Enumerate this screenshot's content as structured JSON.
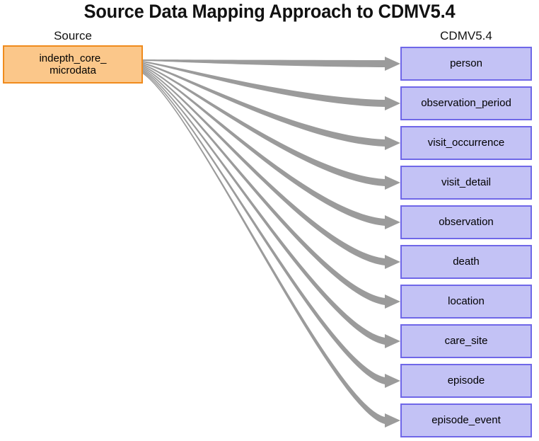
{
  "title": "Source Data Mapping Approach to CDMV5.4",
  "colors": {
    "source_fill": "#FBC78A",
    "source_border": "#F08B1D",
    "target_fill": "#C3C2F5",
    "target_border": "#6F67E8",
    "flow": "#9B9B9B",
    "text": "#000000",
    "background": "#FFFFFF"
  },
  "source": {
    "header": "Source",
    "node": {
      "label": "indepth_core_ microdata",
      "line1": "indepth_core_",
      "line2": "microdata"
    }
  },
  "target": {
    "header": "CDMV5.4",
    "nodes": [
      {
        "label": "person"
      },
      {
        "label": "observation_period"
      },
      {
        "label": "visit_occurrence"
      },
      {
        "label": "visit_detail"
      },
      {
        "label": "observation"
      },
      {
        "label": "death"
      },
      {
        "label": "location"
      },
      {
        "label": "care_site"
      },
      {
        "label": "episode"
      },
      {
        "label": "episode_event"
      }
    ]
  },
  "flows": [
    {
      "from": "indepth_core_microdata",
      "to": "person"
    },
    {
      "from": "indepth_core_microdata",
      "to": "observation_period"
    },
    {
      "from": "indepth_core_microdata",
      "to": "visit_occurrence"
    },
    {
      "from": "indepth_core_microdata",
      "to": "visit_detail"
    },
    {
      "from": "indepth_core_microdata",
      "to": "observation"
    },
    {
      "from": "indepth_core_microdata",
      "to": "death"
    },
    {
      "from": "indepth_core_microdata",
      "to": "location"
    },
    {
      "from": "indepth_core_microdata",
      "to": "care_site"
    },
    {
      "from": "indepth_core_microdata",
      "to": "episode"
    },
    {
      "from": "indepth_core_microdata",
      "to": "episode_event"
    }
  ],
  "chart_data": {
    "type": "diagram",
    "title": "Source Data Mapping Approach to CDMV5.4",
    "diagram_kind": "sankey-style mapping flow",
    "left_column_label": "Source",
    "right_column_label": "CDMV5.4",
    "left_nodes": [
      "indepth_core_microdata"
    ],
    "right_nodes": [
      "person",
      "observation_period",
      "visit_occurrence",
      "visit_detail",
      "observation",
      "death",
      "location",
      "care_site",
      "episode",
      "episode_event"
    ],
    "edges": [
      [
        "indepth_core_microdata",
        "person"
      ],
      [
        "indepth_core_microdata",
        "observation_period"
      ],
      [
        "indepth_core_microdata",
        "visit_occurrence"
      ],
      [
        "indepth_core_microdata",
        "visit_detail"
      ],
      [
        "indepth_core_microdata",
        "observation"
      ],
      [
        "indepth_core_microdata",
        "death"
      ],
      [
        "indepth_core_microdata",
        "location"
      ],
      [
        "indepth_core_microdata",
        "care_site"
      ],
      [
        "indepth_core_microdata",
        "episode"
      ],
      [
        "indepth_core_microdata",
        "episode_event"
      ]
    ],
    "edge_count": 10
  }
}
